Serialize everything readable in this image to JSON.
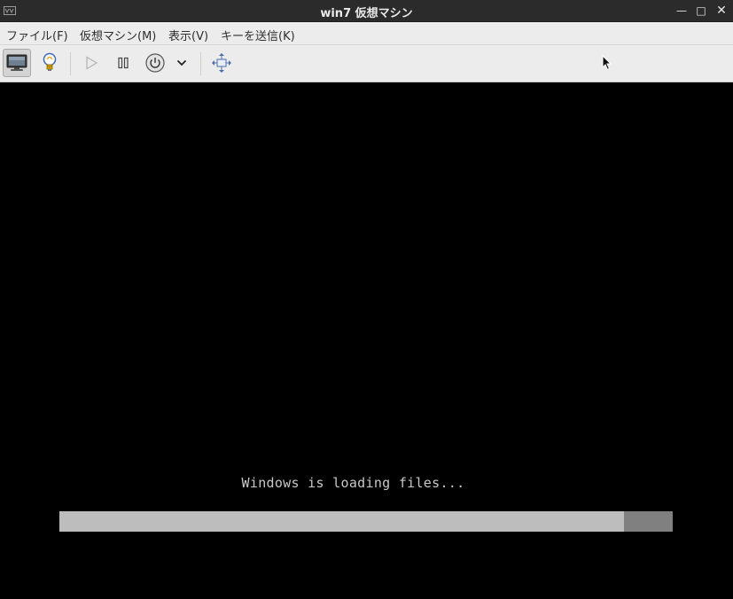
{
  "window": {
    "title": "win7 仮想マシン",
    "min_label": "—",
    "max_label": "□",
    "close_label": "✕"
  },
  "menu": {
    "items": [
      {
        "label": "ファイル(F)"
      },
      {
        "label": "仮想マシン(M)"
      },
      {
        "label": "表示(V)"
      },
      {
        "label": "キーを送信(K)"
      }
    ]
  },
  "toolbar": {
    "buttons": [
      {
        "icon": "monitor-icon",
        "active": true
      },
      {
        "icon": "lightbulb-icon"
      },
      {
        "icon": "play-icon",
        "disabled": true
      },
      {
        "icon": "pause-icon"
      },
      {
        "icon": "power-icon"
      },
      {
        "icon": "chevron-down-icon"
      },
      {
        "icon": "fullscreen-icon"
      }
    ]
  },
  "display": {
    "loading_text": "Windows is loading files...",
    "progress_fraction": 0.92
  },
  "colors": {
    "titlebar": "#2b2b2b",
    "menubar": "#ececec",
    "screen": "#000000",
    "progress_fill": "#bdbdbd",
    "progress_track": "#808080"
  }
}
